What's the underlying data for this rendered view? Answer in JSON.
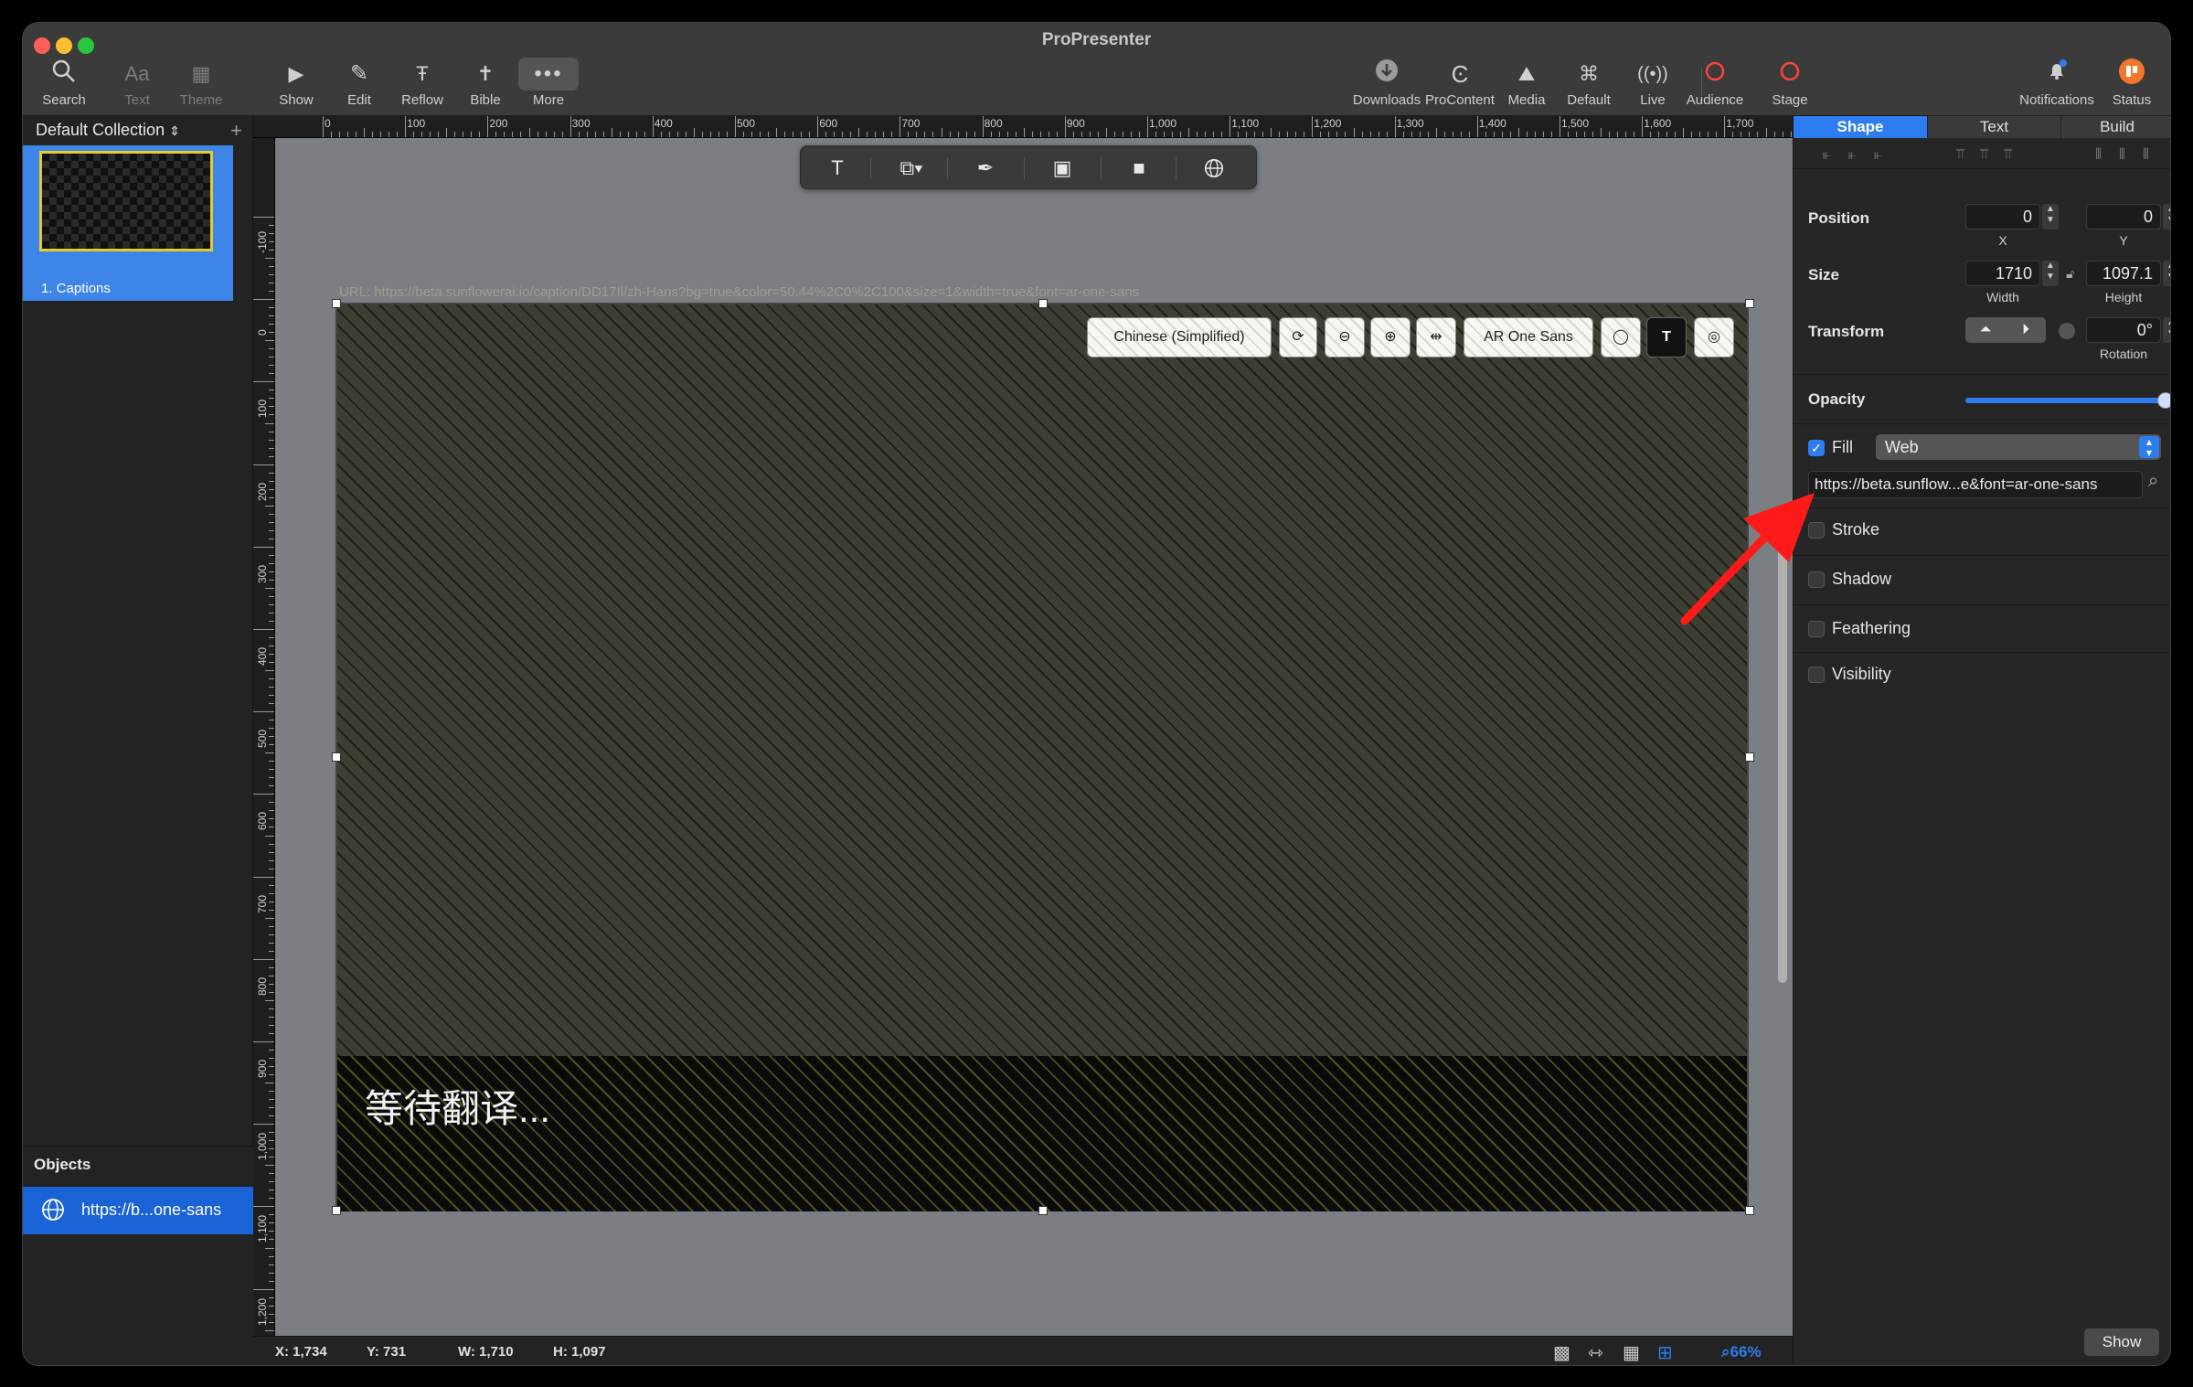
{
  "window": {
    "title": "ProPresenter"
  },
  "toolbar": {
    "left": [
      {
        "label": "Search",
        "icon": "search-icon",
        "dim": false
      },
      {
        "label": "Text",
        "icon": "text-icon",
        "dim": true
      },
      {
        "label": "Theme",
        "icon": "theme-icon",
        "dim": true
      },
      {
        "label": "Show",
        "icon": "play-icon",
        "dim": false
      },
      {
        "label": "Edit",
        "icon": "pencil-icon",
        "dim": false
      },
      {
        "label": "Reflow",
        "icon": "reflow-icon",
        "dim": false
      },
      {
        "label": "Bible",
        "icon": "bible-icon",
        "dim": false
      },
      {
        "label": "More",
        "icon": "more-icon",
        "dim": false
      }
    ],
    "right": [
      {
        "label": "Downloads",
        "icon": "download-icon"
      },
      {
        "label": "ProContent",
        "icon": "procontent-icon"
      },
      {
        "label": "Media",
        "icon": "media-icon"
      },
      {
        "label": "Default",
        "icon": "mustache-icon"
      },
      {
        "label": "Live",
        "icon": "broadcast-icon"
      },
      {
        "label": "Audience",
        "icon": "audience-circle-icon",
        "color": "#ff453a"
      },
      {
        "label": "Stage",
        "icon": "stage-circle-icon",
        "color": "#ff453a"
      },
      {
        "label": "Notifications",
        "icon": "bell-icon"
      },
      {
        "label": "Status",
        "icon": "status-icon",
        "color": "#f0772d"
      }
    ]
  },
  "sidebar": {
    "collection": "Default Collection",
    "slides": [
      {
        "label": "1.  Captions"
      }
    ],
    "objects_title": "Objects",
    "objects": [
      {
        "label": "https://b...one-sans",
        "icon": "globe-icon"
      }
    ]
  },
  "rulers": {
    "top": [
      "0",
      "100",
      "200",
      "300",
      "400",
      "500",
      "600",
      "700",
      "800",
      "900",
      "1,000",
      "1,100",
      "1,200",
      "1,300",
      "1,400",
      "1,500",
      "1,600",
      "1,700"
    ],
    "left": [
      "-100",
      "0",
      "100",
      "200",
      "300",
      "400",
      "500",
      "600",
      "700",
      "800",
      "900",
      "1,000",
      "1,100",
      "1,200"
    ]
  },
  "canvas": {
    "url": "URL: https://beta.sunflowerai.io/caption/DD17Il/zh-Hans?bg=true&color=50.44%2C0%2C100&size=1&width=true&font=ar-one-sans",
    "caption": "等待翻译...",
    "controls": {
      "language": "Chinese (Simplified)",
      "font": "AR One Sans"
    }
  },
  "inspector": {
    "tabs": [
      "Shape",
      "Text",
      "Build"
    ],
    "active_tab": "Shape",
    "position": {
      "label": "Position",
      "x": "0",
      "y": "0",
      "x_label": "X",
      "y_label": "Y"
    },
    "size": {
      "label": "Size",
      "width": "1710",
      "height": "1097.1",
      "width_label": "Width",
      "height_label": "Height"
    },
    "transform": {
      "label": "Transform",
      "rotation": "0°",
      "rotation_label": "Rotation"
    },
    "opacity": {
      "label": "Opacity",
      "value": 1.0
    },
    "fill": {
      "label": "Fill",
      "checked": true,
      "type": "Web",
      "url": "https://beta.sunflow...e&font=ar-one-sans"
    },
    "stroke": {
      "label": "Stroke",
      "checked": false
    },
    "shadow": {
      "label": "Shadow",
      "checked": false
    },
    "feathering": {
      "label": "Feathering",
      "checked": false
    },
    "visibility": {
      "label": "Visibility",
      "checked": false
    },
    "show_button": "Show"
  },
  "statusbar": {
    "x": "X: 1,734",
    "y": "Y: 731",
    "w": "W: 1,710",
    "h": "H: 1,097",
    "zoom": "66%"
  },
  "colors": {
    "accent": "#2e7df0",
    "selection_yellow": "#e6cc2a",
    "record_red": "#ff453a",
    "arrow_red": "#ff1a1a"
  }
}
